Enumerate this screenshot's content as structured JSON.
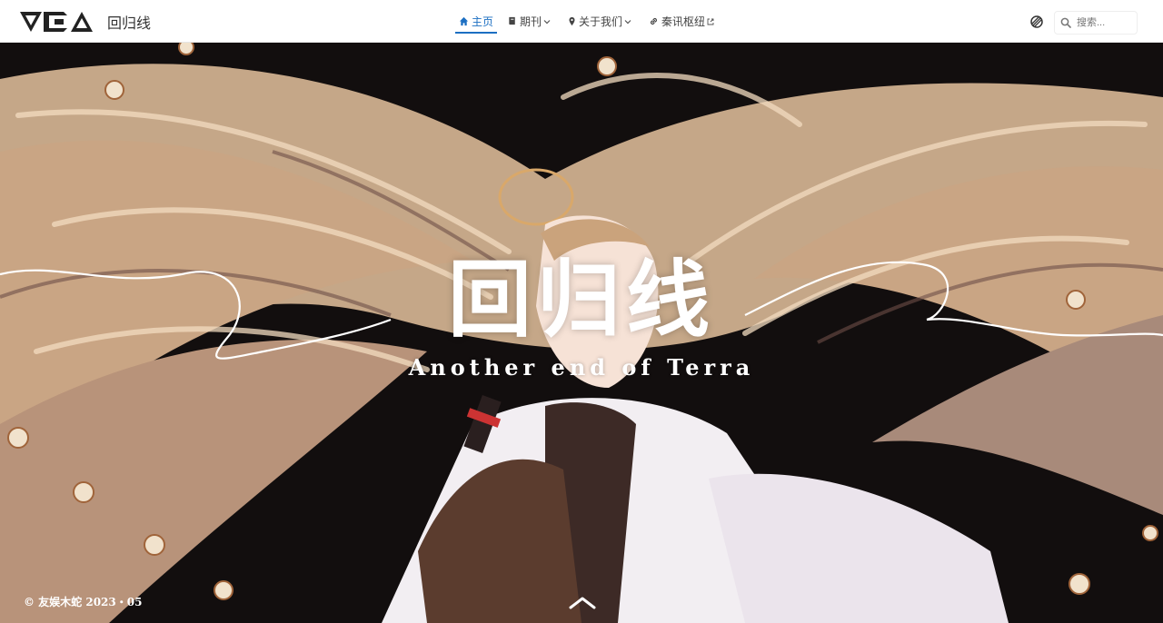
{
  "header": {
    "site_name": "回归线",
    "logo_icon": "vca-logo-icon"
  },
  "nav": {
    "items": [
      {
        "label": "主页",
        "icon": "home-icon",
        "active": true,
        "has_dropdown": false
      },
      {
        "label": "期刊",
        "icon": "book-icon",
        "active": false,
        "has_dropdown": true
      },
      {
        "label": "关于我们",
        "icon": "pin-icon",
        "active": false,
        "has_dropdown": true
      },
      {
        "label": "秦讯枢纽",
        "icon": "link-icon",
        "active": false,
        "external": true
      }
    ]
  },
  "search": {
    "placeholder": "搜索..."
  },
  "hero": {
    "title": "回归线",
    "subtitle": "Another end of Terra"
  },
  "footer": {
    "copyright": "© 友娱木蛇 2023・05"
  },
  "colors": {
    "accent": "#1c6fc2",
    "hair": "#e8c9a4",
    "background_dark": "#120e0e"
  }
}
